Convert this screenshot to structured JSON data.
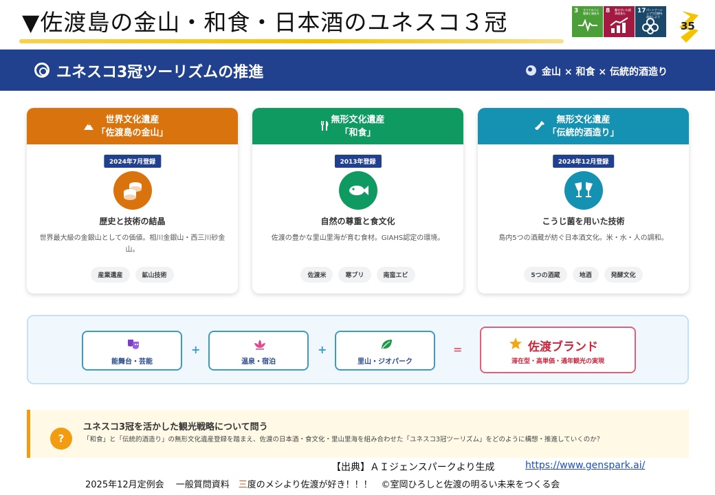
{
  "slide": {
    "title": "▼佐渡島の金山・和食・日本酒のユネスコ３冠",
    "page_number": "35",
    "sdg_icons": [
      {
        "number": "3",
        "caption": "すべての人に健康と福祉を",
        "color": "#4c9f38",
        "icon": "heartbeat-icon"
      },
      {
        "number": "8",
        "caption": "働きがいも経済成長も",
        "color": "#a21942",
        "icon": "growth-chart-icon"
      },
      {
        "number": "17",
        "caption": "パートナーシップで目標を達成しよう",
        "color": "#19486a",
        "icon": "partnership-icon"
      }
    ]
  },
  "banner": {
    "title": "ユネスコ3冠ツーリズムの推進",
    "subtitle": "金山 × 和食 × 伝統的酒造り"
  },
  "cards": [
    {
      "category": "世界文化遺産",
      "name": "「佐渡島の金山」",
      "color": "#d9730d",
      "badge": "2024年7月登録",
      "icon": "gold-coins-icon",
      "heading": "歴史と技術の結晶",
      "description": "世界最大級の金銀山としての価値。相川金銀山・西三川砂金山。",
      "tags": [
        "産業遺産",
        "鉱山技術"
      ]
    },
    {
      "category": "無形文化遺産",
      "name": "「和食」",
      "color": "#0e9a60",
      "badge": "2013年登録",
      "icon": "fish-icon",
      "heading": "自然の尊重と食文化",
      "description": "佐渡の豊かな里山里海が育む食材。GIAHS認定の環境。",
      "tags": [
        "佐渡米",
        "寒ブリ",
        "南蛮エビ"
      ]
    },
    {
      "category": "無形文化遺産",
      "name": "「伝統的酒造り」",
      "color": "#1592b2",
      "badge": "2024年12月登録",
      "icon": "sake-cheers-icon",
      "heading": "こうじ菌を用いた技術",
      "description": "島内5つの酒蔵が紡ぐ日本酒文化。米・水・人の調和。",
      "tags": [
        "5つの酒蔵",
        "地酒",
        "発酵文化"
      ]
    }
  ],
  "formula": {
    "items": [
      {
        "label": "能舞台・芸能",
        "icon": "theater-masks-icon",
        "color": "#7b3fc4"
      },
      {
        "label": "温泉・宿泊",
        "icon": "lotus-icon",
        "color": "#e04a8f"
      },
      {
        "label": "里山・ジオパーク",
        "icon": "leaf-icon",
        "color": "#1e9a4a"
      }
    ],
    "plus": "+",
    "equals": "=",
    "result": {
      "title": "佐渡ブランド",
      "subtitle": "滞在型・高単価・通年観光の実現"
    }
  },
  "question": {
    "icon_label": "?",
    "title": "ユネスコ3冠を活かした観光戦略について問う",
    "text": "「和食」と「伝統的酒造り」の無形文化遺産登録を踏まえ、佐渡の日本酒・食文化・里山里海を組み合わせた「ユネスコ3冠ツーリズム」をどのように構想・推進していくのか？"
  },
  "footer": {
    "source_label": "【出典】ＡＩジェンスパークより生成",
    "source_url": "https://www.genspark.ai/",
    "line_pre": "2025年12月定例会　 一般質問資料　",
    "line_highlight": "三",
    "line_post": "度のメシより佐渡が好き！！！　©室岡ひろしと佐渡の明るい未来をつくる会"
  }
}
